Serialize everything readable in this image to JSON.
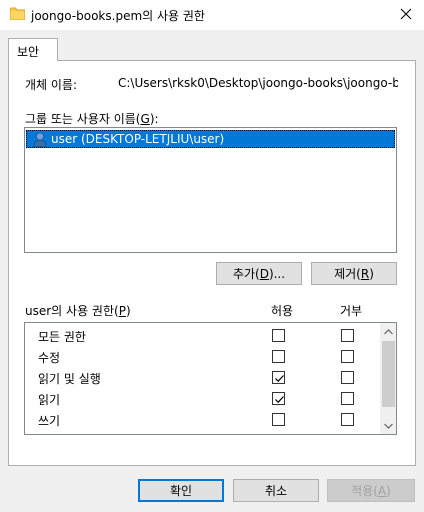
{
  "window": {
    "title": "joongo-books.pem의 사용 권한",
    "close_glyph": "✕"
  },
  "tab": {
    "label": "보안"
  },
  "object": {
    "label": "개체 이름:",
    "value": "C:\\Users\\rksk0\\Desktop\\joongo-books\\joongo-b"
  },
  "groups": {
    "label_prefix": "그룹 또는 사용자 이름(",
    "label_key": "G",
    "label_suffix": "):",
    "items": [
      {
        "label": "user (DESKTOP-LETJLIU\\user)",
        "selected": true
      }
    ]
  },
  "buttons": {
    "add": {
      "prefix": "추가(",
      "key": "D",
      "suffix": ")..."
    },
    "remove": {
      "prefix": "제거(",
      "key": "R",
      "suffix": ")"
    },
    "ok": "확인",
    "cancel": "취소",
    "apply": {
      "prefix": "적용(",
      "key": "A",
      "suffix": ")"
    }
  },
  "permissions": {
    "label_prefix": "user의 사용 권한(",
    "label_key": "P",
    "label_suffix": ")",
    "allow_header": "허용",
    "deny_header": "거부",
    "rows": [
      {
        "name": "모든 권한",
        "allow": false,
        "deny": false
      },
      {
        "name": "수정",
        "allow": false,
        "deny": false
      },
      {
        "name": "읽기 및 실행",
        "allow": true,
        "deny": false
      },
      {
        "name": "읽기",
        "allow": true,
        "deny": false
      },
      {
        "name": "쓰기",
        "allow": false,
        "deny": false
      }
    ]
  },
  "colors": {
    "selection": "#0078d7",
    "primary_border": "#0078d7"
  }
}
